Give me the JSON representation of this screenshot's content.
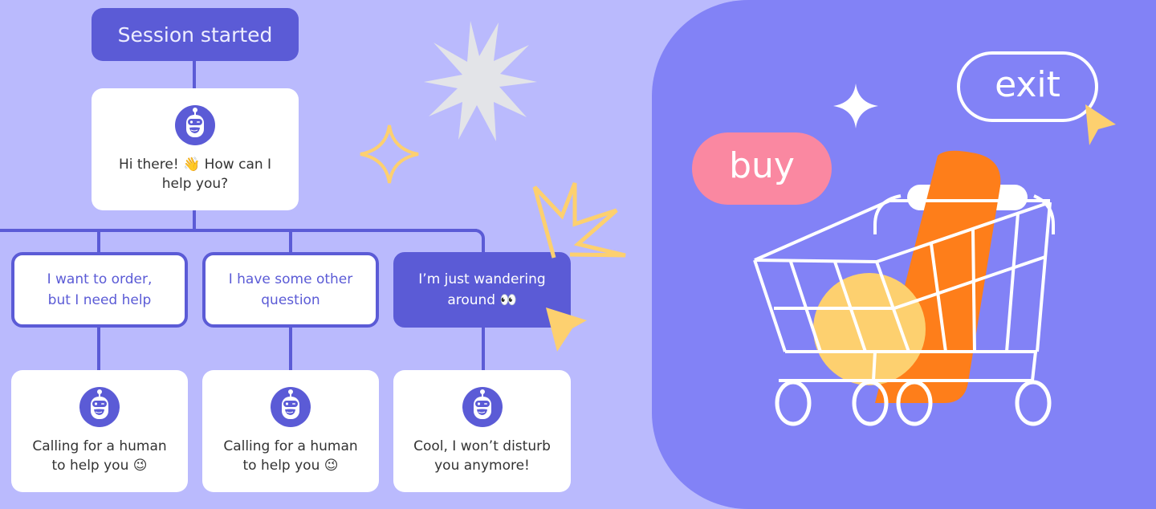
{
  "flow": {
    "root": {
      "label": "Session started"
    },
    "greeting": {
      "icon": "robot-icon",
      "text": "Hi there! 👋 How can I help you?"
    },
    "choices": [
      {
        "label": "I want to order, but I need help",
        "selected": false
      },
      {
        "label": "I have some other question",
        "selected": false
      },
      {
        "label": "I’m just wandering around 👀",
        "selected": true
      }
    ],
    "responses": [
      {
        "icon": "robot-icon",
        "text": "Calling for a human to help you 😉"
      },
      {
        "icon": "robot-icon",
        "text": "Calling for a human to help you 😉"
      },
      {
        "icon": "robot-icon",
        "text": "Cool, I won’t disturb you anymore!"
      }
    ]
  },
  "illustration": {
    "buy_label": "buy",
    "exit_label": "exit"
  },
  "colors": {
    "background": "#babafd",
    "accent": "#5b5bd6",
    "panel": "#8282f6",
    "buy": "#fa88a1",
    "orange": "#fe7e1a",
    "yellow": "#fdd06f",
    "star_gray": "#e3e4e8"
  }
}
